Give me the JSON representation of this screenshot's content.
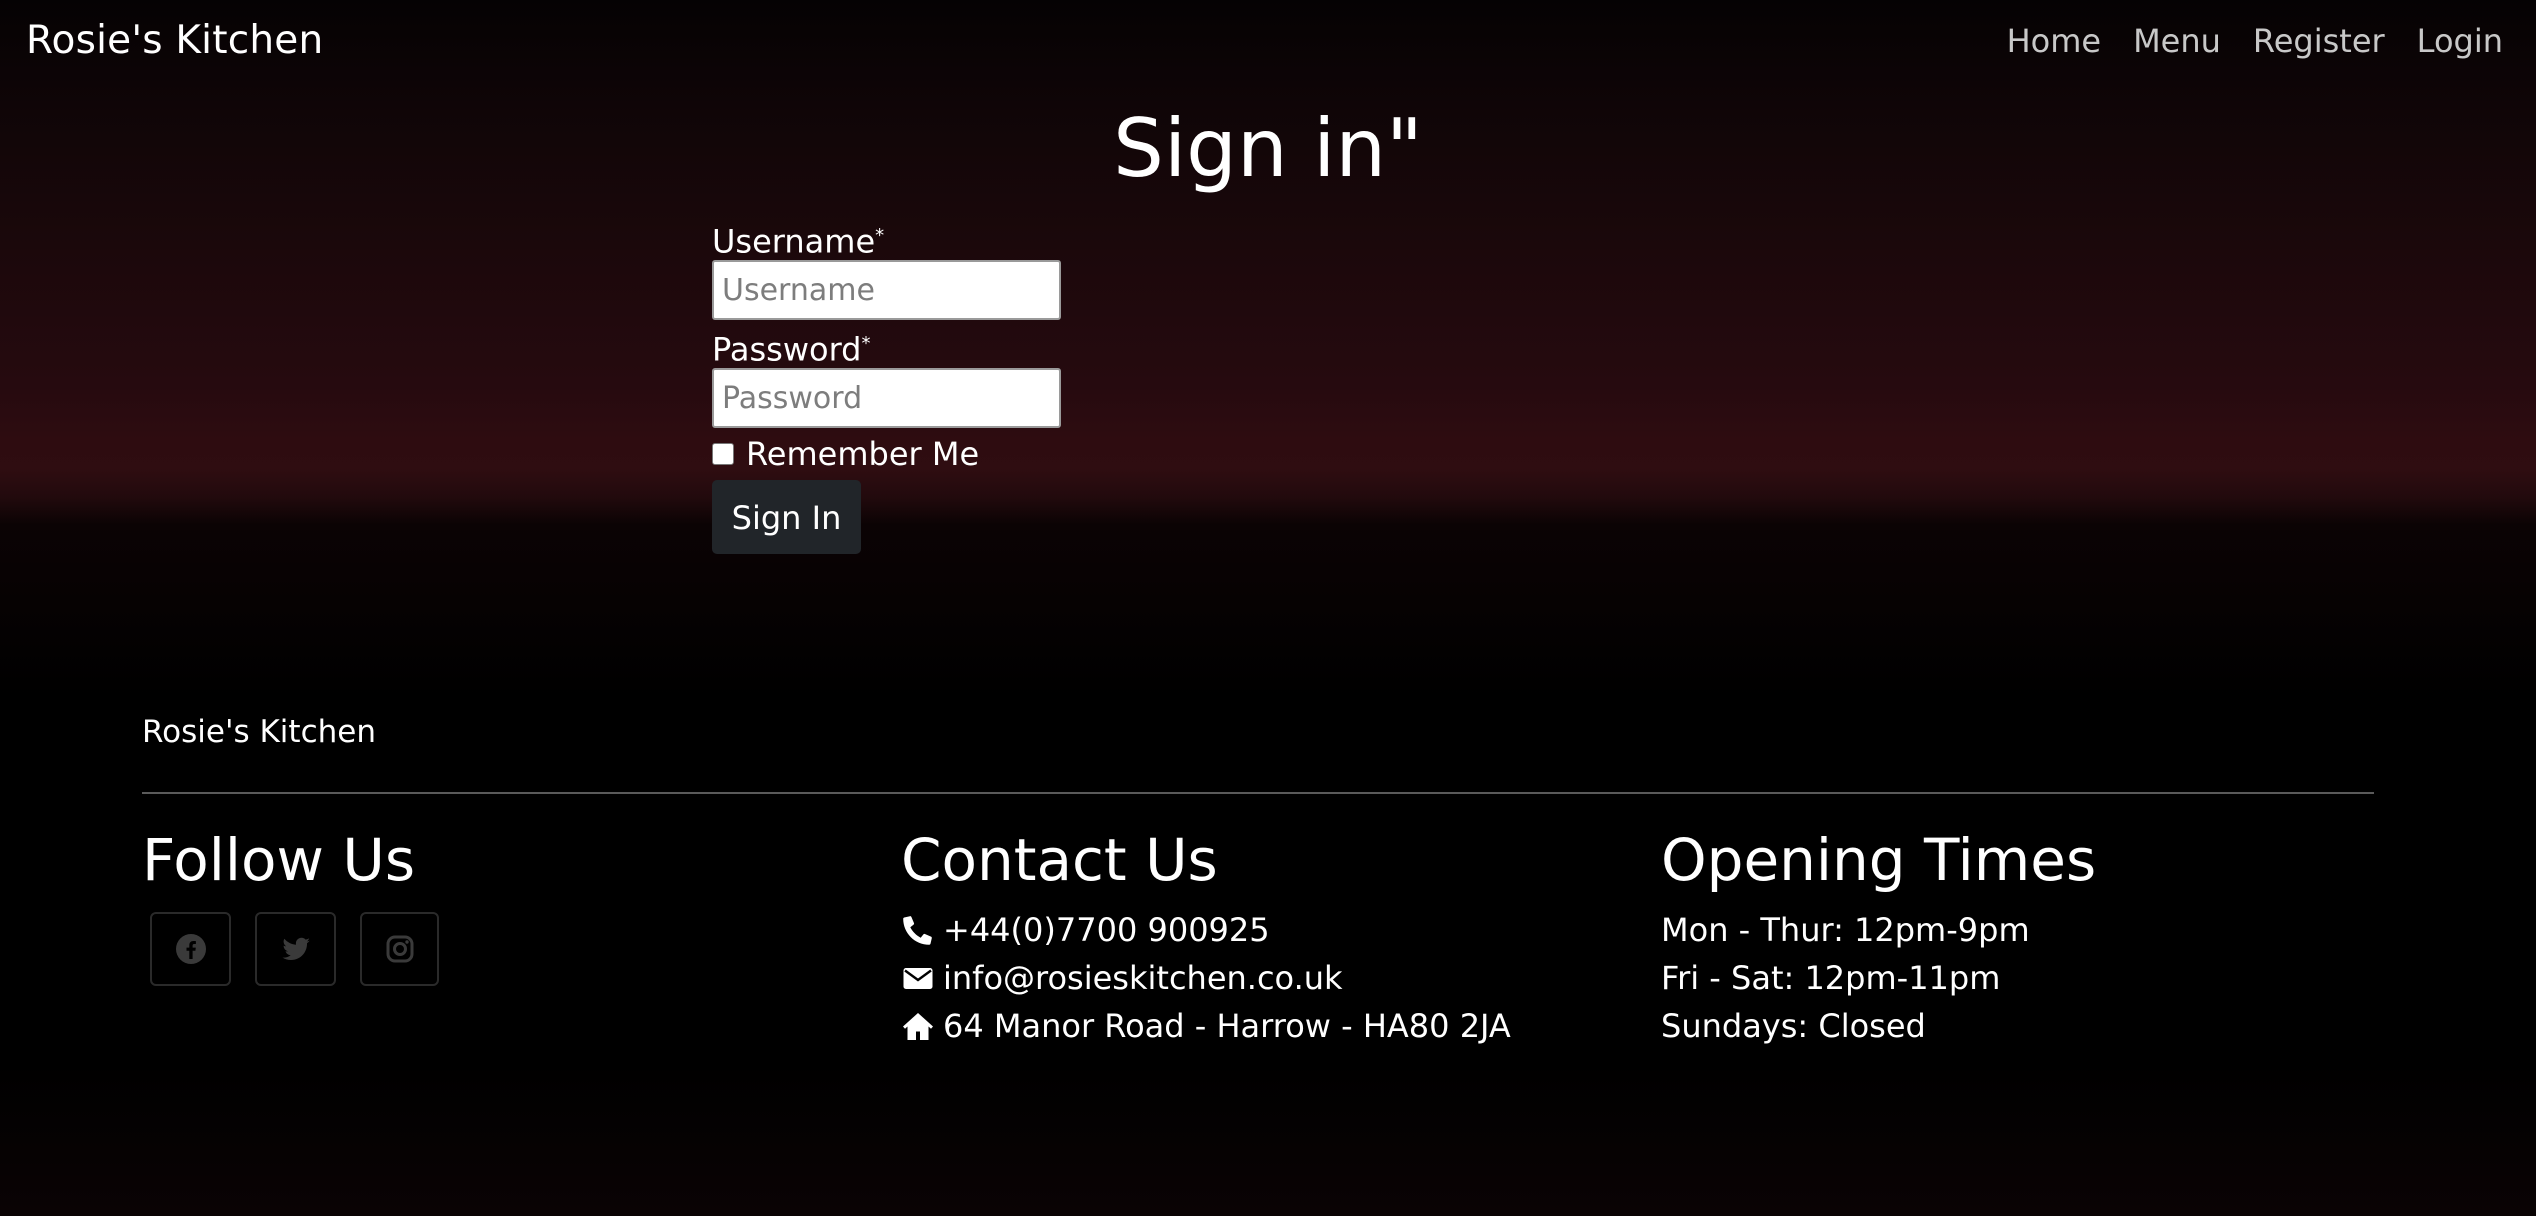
{
  "navbar": {
    "brand": "Rosie's Kitchen",
    "links": [
      "Home",
      "Menu",
      "Register",
      "Login"
    ]
  },
  "signin": {
    "title": "Sign in\"",
    "username_label": "Username",
    "username_placeholder": "Username",
    "password_label": "Password",
    "password_placeholder": "Password",
    "required_marker": "*",
    "remember_label": "Remember Me",
    "submit_label": "Sign In"
  },
  "footer": {
    "brand": "Rosie's Kitchen",
    "follow": {
      "heading": "Follow Us",
      "icons": [
        "facebook-icon",
        "twitter-icon",
        "instagram-icon"
      ]
    },
    "contact": {
      "heading": "Contact Us",
      "phone": "+44(0)7700 900925",
      "email": "info@rosieskitchen.co.uk",
      "address": "64 Manor Road - Harrow - HA80 2JA"
    },
    "hours": {
      "heading": "Opening Times",
      "lines": [
        "Mon - Thur: 12pm-9pm",
        "Fri - Sat: 12pm-11pm",
        "Sundays: Closed"
      ]
    }
  },
  "colors": {
    "background": "#000000",
    "header_gradient_accent": "#2f0d11",
    "button_bg": "#212529",
    "nav_link": "#c8c8c8",
    "social_icon": "#3a3a3a"
  }
}
